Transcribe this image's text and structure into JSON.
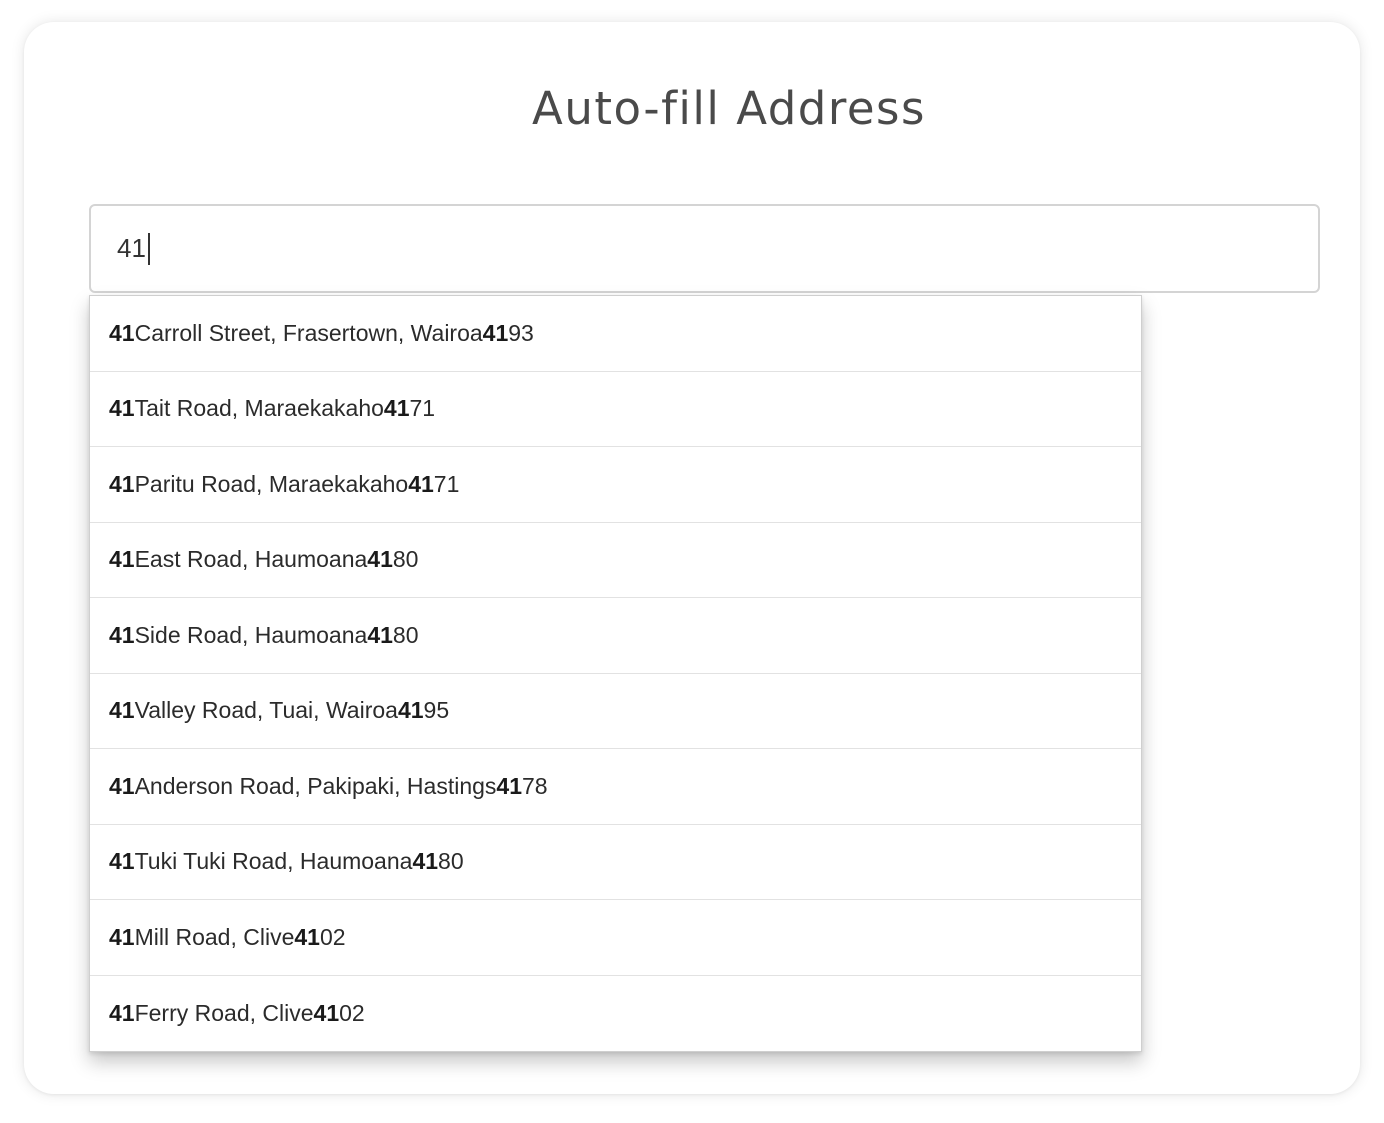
{
  "page": {
    "title": "Auto-fill Address"
  },
  "search": {
    "value": "41"
  },
  "suggestions": [
    {
      "num": "41",
      "rest": " Carroll Street, Frasertown, Wairoa ",
      "pc_bold": "41",
      "pc_rest": "93"
    },
    {
      "num": "41",
      "rest": " Tait Road, Maraekakaho ",
      "pc_bold": "41",
      "pc_rest": "71"
    },
    {
      "num": "41",
      "rest": " Paritu Road, Maraekakaho ",
      "pc_bold": "41",
      "pc_rest": "71"
    },
    {
      "num": "41",
      "rest": " East Road, Haumoana ",
      "pc_bold": "41",
      "pc_rest": "80"
    },
    {
      "num": "41",
      "rest": " Side Road, Haumoana ",
      "pc_bold": "41",
      "pc_rest": "80"
    },
    {
      "num": "41",
      "rest": " Valley Road, Tuai, Wairoa ",
      "pc_bold": "41",
      "pc_rest": "95"
    },
    {
      "num": "41",
      "rest": " Anderson Road, Pakipaki, Hastings ",
      "pc_bold": "41",
      "pc_rest": "78"
    },
    {
      "num": "41",
      "rest": " Tuki Tuki Road, Haumoana ",
      "pc_bold": "41",
      "pc_rest": "80"
    },
    {
      "num": "41",
      "rest": " Mill Road, Clive ",
      "pc_bold": "41",
      "pc_rest": "02"
    },
    {
      "num": "41",
      "rest": " Ferry Road, Clive ",
      "pc_bold": "41",
      "pc_rest": "02"
    }
  ]
}
